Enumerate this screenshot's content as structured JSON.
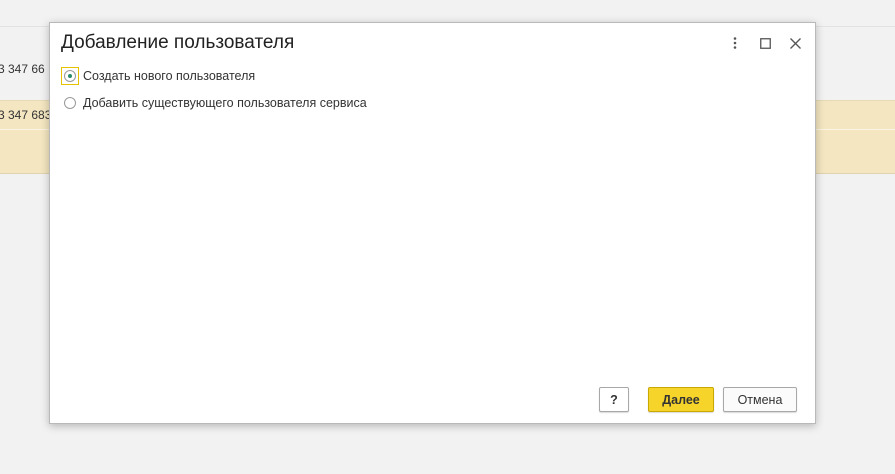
{
  "background": {
    "row1_text": "3 347 66",
    "row2_text": "3 347 683",
    "highlight_color": "#f3e6c0"
  },
  "dialog": {
    "title": "Добавление пользователя",
    "tools": {
      "more_icon": "more-vertical-icon",
      "maximize_icon": "maximize-icon",
      "close_icon": "close-icon"
    },
    "options": [
      {
        "label": "Создать нового пользователя",
        "selected": true
      },
      {
        "label": "Добавить существующего пользователя сервиса",
        "selected": false
      }
    ],
    "buttons": {
      "help_label": "?",
      "next_label": "Далее",
      "cancel_label": "Отмена"
    },
    "accent_color": "#f6d42a",
    "radio_selected_color": "#2d8c6a"
  }
}
